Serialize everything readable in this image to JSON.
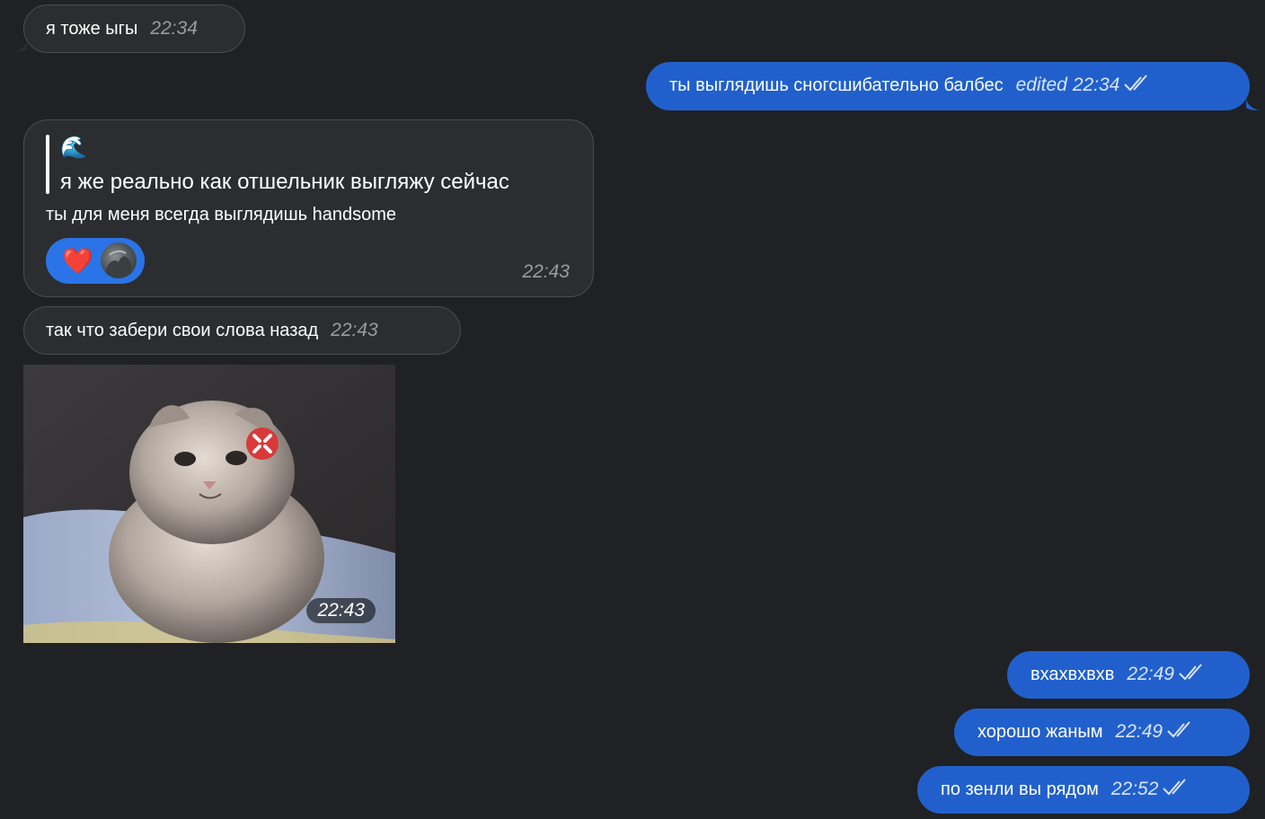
{
  "messages": [
    {
      "text": "я тоже ыгы",
      "time": "22:34"
    },
    {
      "text": "ты выглядишь сногсшибательно балбес",
      "edited": "edited",
      "time": "22:34"
    },
    {
      "quote_emoji": "🌊",
      "quote_text": "я же реально как отшельник выгляжу сейчас",
      "text": "ты для меня всегда выглядишь handsome",
      "reaction": "❤️",
      "time": "22:43"
    },
    {
      "text": "так что забери свои слова назад",
      "time": "22:43"
    },
    {
      "photo_caption_time": "22:43"
    },
    {
      "text": "вхахвхвхв",
      "time": "22:49"
    },
    {
      "text": "хорошо жаным",
      "time": "22:49"
    },
    {
      "text": "по зенли вы рядом",
      "time": "22:52"
    }
  ],
  "colors": {
    "background": "#1f2124",
    "incoming_bubble": "#2b2d30",
    "outgoing_bubble": "#2160cc"
  },
  "icons": {
    "read_status": "double-check-icon",
    "reaction_avatar": "avatar"
  }
}
